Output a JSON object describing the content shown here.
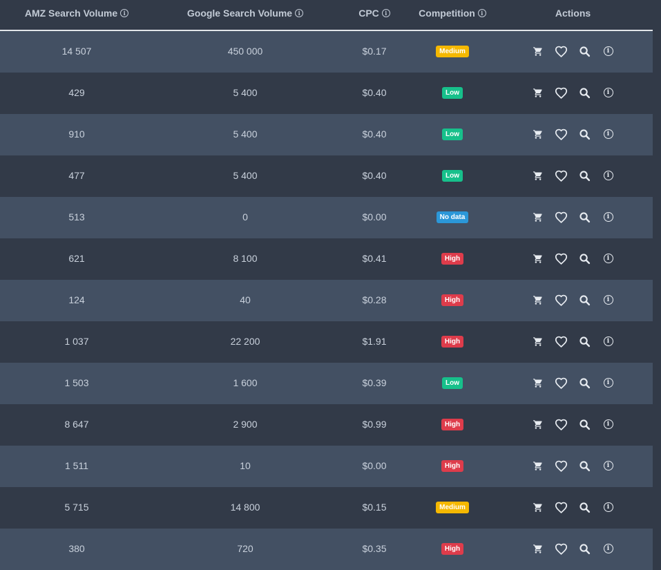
{
  "headers": {
    "amz": "AMZ Search Volume",
    "google": "Google Search Volume",
    "cpc": "CPC",
    "competition": "Competition",
    "actions": "Actions"
  },
  "colors": {
    "Medium": "#f5b800",
    "Low": "#17c08b",
    "High": "#de3c4b",
    "No data": "#2b97d8"
  },
  "rows": [
    {
      "amz": "14 507",
      "google": "450 000",
      "cpc": "$0.17",
      "competition": "Medium"
    },
    {
      "amz": "429",
      "google": "5 400",
      "cpc": "$0.40",
      "competition": "Low"
    },
    {
      "amz": "910",
      "google": "5 400",
      "cpc": "$0.40",
      "competition": "Low"
    },
    {
      "amz": "477",
      "google": "5 400",
      "cpc": "$0.40",
      "competition": "Low"
    },
    {
      "amz": "513",
      "google": "0",
      "cpc": "$0.00",
      "competition": "No data"
    },
    {
      "amz": "621",
      "google": "8 100",
      "cpc": "$0.41",
      "competition": "High"
    },
    {
      "amz": "124",
      "google": "40",
      "cpc": "$0.28",
      "competition": "High"
    },
    {
      "amz": "1 037",
      "google": "22 200",
      "cpc": "$1.91",
      "competition": "High"
    },
    {
      "amz": "1 503",
      "google": "1 600",
      "cpc": "$0.39",
      "competition": "Low"
    },
    {
      "amz": "8 647",
      "google": "2 900",
      "cpc": "$0.99",
      "competition": "High"
    },
    {
      "amz": "1 511",
      "google": "10",
      "cpc": "$0.00",
      "competition": "High"
    },
    {
      "amz": "5 715",
      "google": "14 800",
      "cpc": "$0.15",
      "competition": "Medium"
    },
    {
      "amz": "380",
      "google": "720",
      "cpc": "$0.35",
      "competition": "High"
    }
  ]
}
